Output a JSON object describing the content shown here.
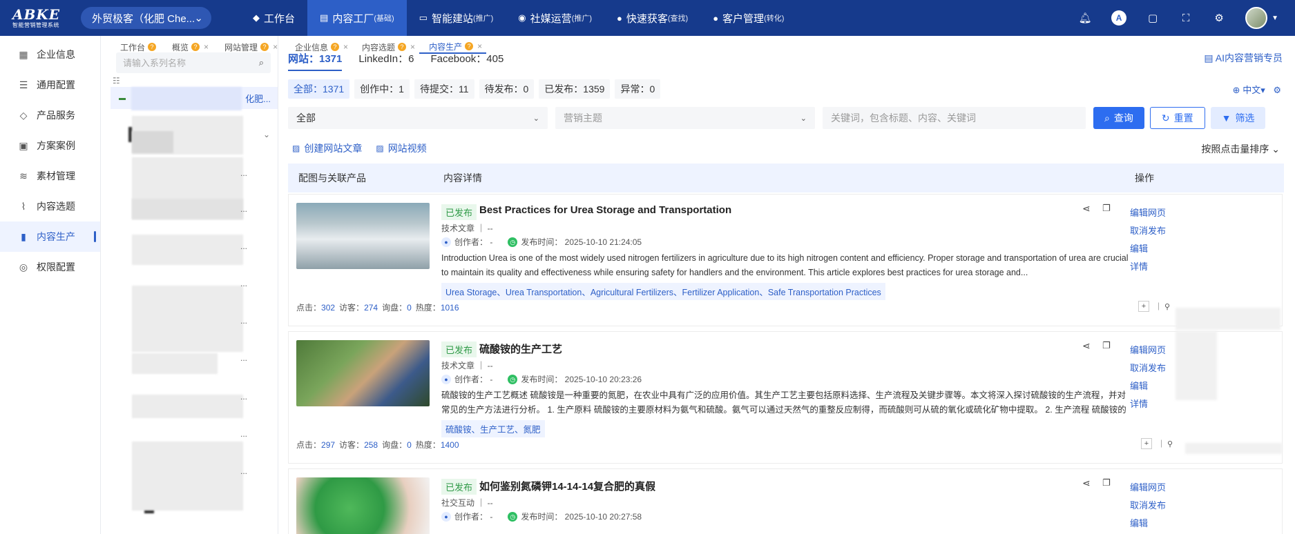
{
  "logo": {
    "brand": "ABKE",
    "tagline": "智能营销管理系统"
  },
  "tenant": {
    "name": "外贸极客（化肥 Che..."
  },
  "topnav": [
    {
      "label": "工作台",
      "sub": "",
      "icon": "cube-icon"
    },
    {
      "label": "内容工厂",
      "sub": "(基础)",
      "icon": "document-icon",
      "active": true
    },
    {
      "label": "智能建站",
      "sub": "(推广)",
      "icon": "monitor-icon"
    },
    {
      "label": "社媒运营",
      "sub": "(推广)",
      "icon": "social-icon"
    },
    {
      "label": "快速获客",
      "sub": "(查找)",
      "icon": "user-icon"
    },
    {
      "label": "客户管理",
      "sub": "(转化)",
      "icon": "users-icon"
    }
  ],
  "sidebar": {
    "items": [
      {
        "label": "企业信息",
        "icon": "building-icon"
      },
      {
        "label": "通用配置",
        "icon": "sliders-icon"
      },
      {
        "label": "产品服务",
        "icon": "box-icon"
      },
      {
        "label": "方案案例",
        "icon": "calendar-icon"
      },
      {
        "label": "素材管理",
        "icon": "layers-icon"
      },
      {
        "label": "内容选题",
        "icon": "chart-icon"
      },
      {
        "label": "内容生产",
        "icon": "book-icon",
        "active": true
      },
      {
        "label": "权限配置",
        "icon": "shield-icon"
      }
    ]
  },
  "left_tabs": [
    {
      "label": "工作台",
      "help": "?"
    },
    {
      "label": "概览",
      "help": "?",
      "close": "×"
    },
    {
      "label": "网站管理",
      "help": "?",
      "close": "×"
    }
  ],
  "right_tabs": [
    {
      "label": "企业信息",
      "help": "?",
      "close": "×"
    },
    {
      "label": "内容选题",
      "help": "?",
      "close": "×"
    },
    {
      "label": "内容生产",
      "help": "?",
      "close": "×",
      "active": true
    }
  ],
  "series": {
    "search_placeholder": "请输入系列名称",
    "selected_label": "化肥...",
    "truncs": [
      "...",
      "...",
      "...",
      "...",
      "...",
      "...",
      "...",
      "...",
      "..."
    ]
  },
  "channels": [
    {
      "label": "网站：1371",
      "active": true
    },
    {
      "label": "LinkedIn：6"
    },
    {
      "label": "Facebook：405"
    }
  ],
  "ai_specialist": "AI内容营销专员",
  "status_filters": [
    {
      "label": "全部：1371",
      "active": true
    },
    {
      "label": "创作中：1"
    },
    {
      "label": "待提交：11"
    },
    {
      "label": "待发布：0"
    },
    {
      "label": "已发布：1359"
    },
    {
      "label": "异常：0"
    }
  ],
  "language": "中文",
  "filters": {
    "category": "全部",
    "topic_placeholder": "营销主题",
    "keyword_placeholder": "关键词，包含标题、内容、关键词",
    "query": "查询",
    "reset": "重置",
    "screen": "筛选"
  },
  "actions": {
    "create_article": "创建网站文章",
    "site_video": "网站视频"
  },
  "sort": "按照点击量排序",
  "table_headers": {
    "c1": "配图与关联产品",
    "c2": "内容详情",
    "c3": "操作"
  },
  "rows": [
    {
      "status": "已发布",
      "title": "Best Practices for Urea Storage and Transportation",
      "type": "技术文章 ｜ --",
      "author": "创作者： -",
      "publish": "发布时间： 2025-10-10 21:24:05",
      "desc": "Introduction Urea is one of the most widely used nitrogen fertilizers in agriculture due to its high nitrogen content and efficiency. Proper storage and transportation of urea are crucial to maintain its quality and effectiveness while ensuring safety for handlers and the environment. This article explores best practices for urea storage and...",
      "tags": "Urea Storage、Urea Transportation、Agricultural Fertilizers、Fertilizer Application、Safe Transportation Practices",
      "stats": {
        "clicks_l": "点击：",
        "clicks": "302",
        "visitors_l": "访客：",
        "visitors": "274",
        "inquiries_l": "询盘：",
        "inquiries": "0",
        "heat_l": "热度：",
        "heat": "1016"
      },
      "ops": [
        "编辑网页",
        "取消发布",
        "编辑",
        "详情"
      ]
    },
    {
      "status": "已发布",
      "title": "硫酸铵的生产工艺",
      "type": "技术文章 ｜ --",
      "author": "创作者： -",
      "publish": "发布时间： 2025-10-10 20:23:26",
      "desc": "硫酸铵的生产工艺概述 硫酸铵是一种重要的氮肥，在农业中具有广泛的应用价值。其生产工艺主要包括原料选择、生产流程及关键步骤等。本文将深入探讨硫酸铵的生产流程，并对常见的生产方法进行分析。 1. 生产原料 硫酸铵的主要原材料为氨气和硫酸。氨气可以通过天然气的重整反应制得，而硫酸则可从硫的氧化或硫化矿物中提取。 2. 生产流程 硫酸铵的生...",
      "tags": "硫酸铵、生产工艺、氮肥",
      "stats": {
        "clicks_l": "点击：",
        "clicks": "297",
        "visitors_l": "访客：",
        "visitors": "258",
        "inquiries_l": "询盘：",
        "inquiries": "0",
        "heat_l": "热度：",
        "heat": "1400"
      },
      "ops": [
        "编辑网页",
        "取消发布",
        "编辑",
        "详情"
      ]
    },
    {
      "status": "已发布",
      "title": "如何鉴别氮磷钾14-14-14复合肥的真假",
      "type": "社交互动 ｜ --",
      "author": "创作者： -",
      "publish": "发布时间： 2025-10-10 20:27:58",
      "ops": [
        "编辑网页",
        "取消发布",
        "编辑"
      ]
    }
  ]
}
